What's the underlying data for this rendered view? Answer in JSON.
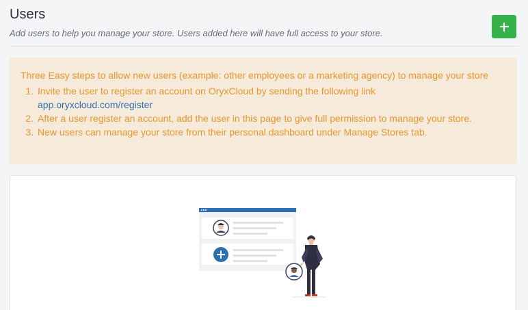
{
  "header": {
    "title": "Users",
    "subtitle": "Add users to help you manage your store. Users added here will have full access to your store."
  },
  "add_button": {
    "icon": "plus-icon"
  },
  "notice": {
    "intro": "Three Easy steps to allow new users (example: other employees or a marketing agency) to manage your store",
    "steps": [
      "Invite the user to register an account on OryxCloud by sending the following link",
      "After a user register an account, add the user in this page to give full permission to manage your store.",
      "New users can manage your store from their personal dashboard under Manage Stores tab."
    ],
    "link": "app.oryxcloud.com/register"
  },
  "colors": {
    "accent_green": "#36b24a",
    "notice_bg": "#f6ebdb",
    "notice_text": "#e8962d",
    "link": "#2f6fb0",
    "illustration_blue": "#2d6fb3"
  }
}
